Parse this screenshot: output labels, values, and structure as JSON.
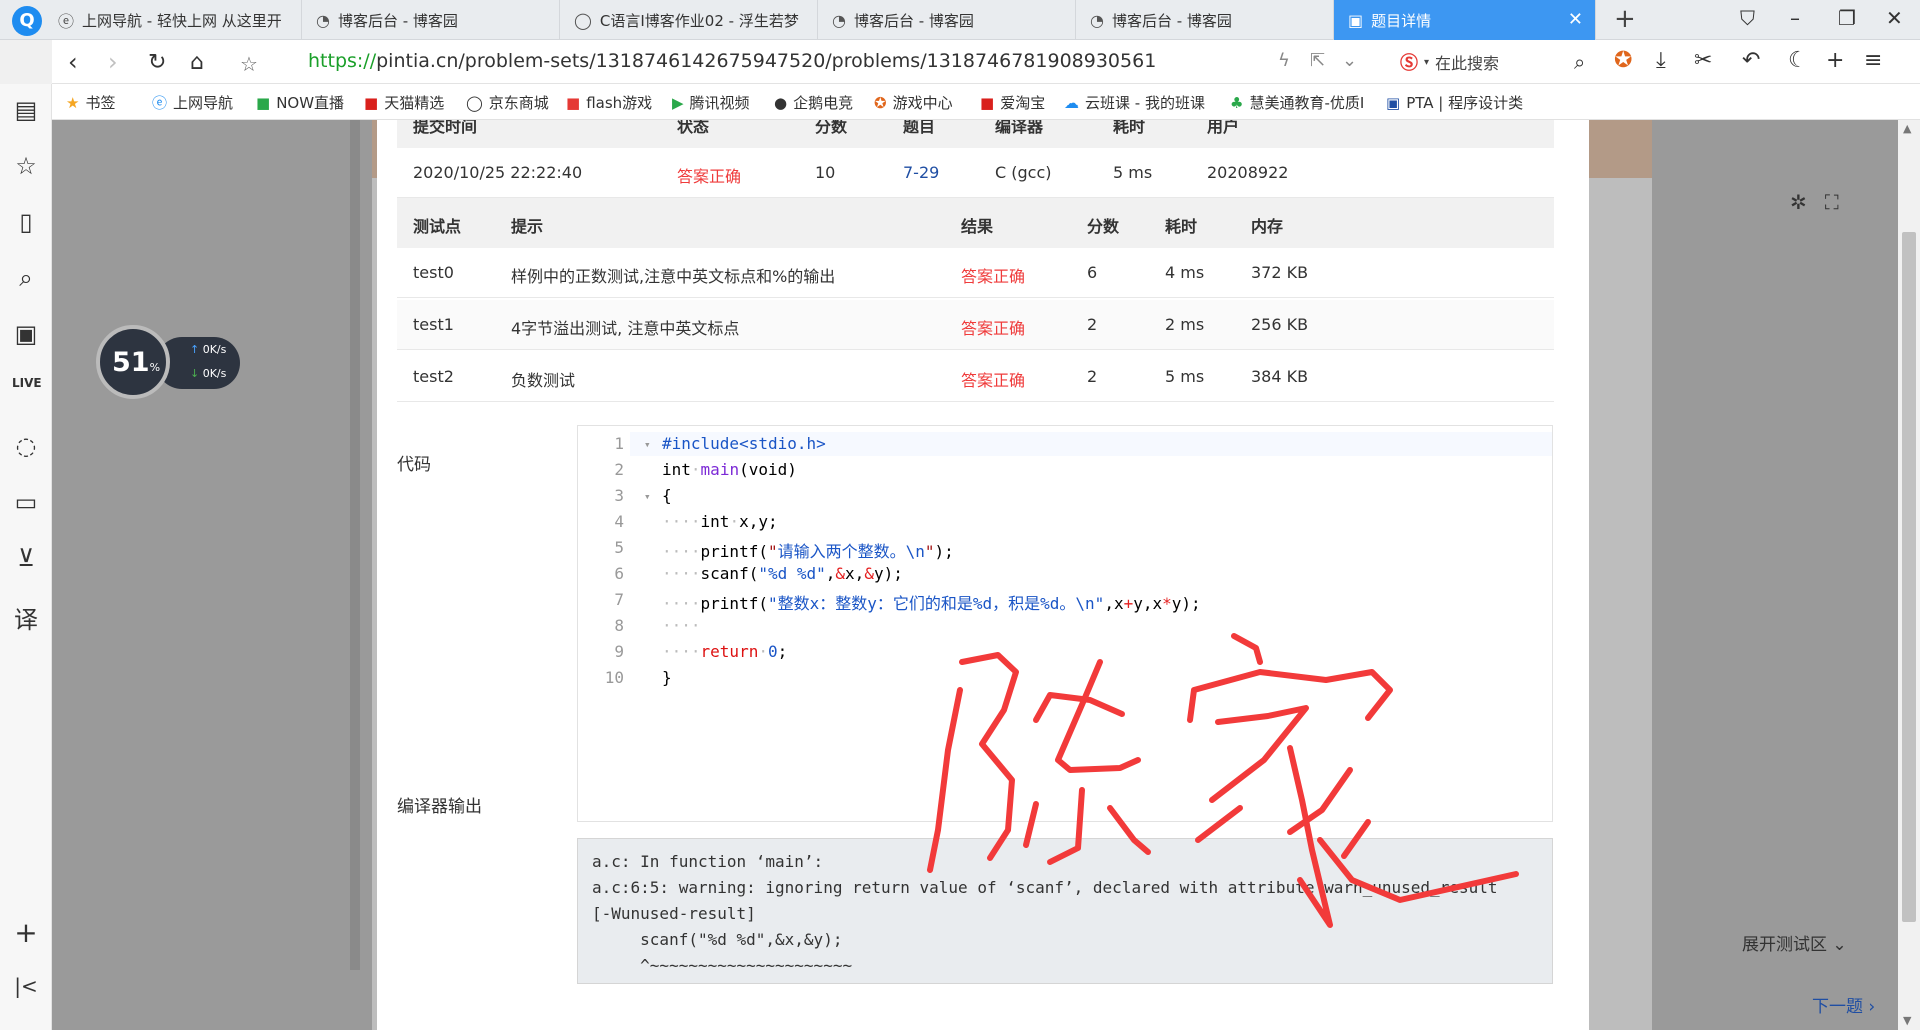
{
  "browser": {
    "tabs": [
      {
        "label": "上网导航 - 轻快上网 从这里开",
        "icon": "e-icon"
      },
      {
        "label": "博客后台 - 博客园",
        "icon": "cnblogs-icon"
      },
      {
        "label": "C语言I博客作业02 - 浮生若梦",
        "icon": "globe-icon"
      },
      {
        "label": "博客后台 - 博客园",
        "icon": "cnblogs-icon"
      },
      {
        "label": "博客后台 - 博客园",
        "icon": "cnblogs-icon"
      },
      {
        "label": "题目详情",
        "icon": "pta-icon"
      }
    ],
    "url_scheme": "https://",
    "url_rest": "pintia.cn/problem-sets/1318746142675947520/problems/1318746781908930561",
    "search_placeholder": "在此搜索",
    "bookmarks": [
      "书签",
      "上网导航",
      "NOW直播",
      "天猫精选",
      "京东商城",
      "flash游戏",
      "腾讯视频",
      "企鹅电竞",
      "游戏中心",
      "爱淘宝",
      "云班课 - 我的班课",
      "慧美通教育-优质I",
      "PTA | 程序设计类"
    ]
  },
  "speed": {
    "percent": "51",
    "percent_unit": "%",
    "up": "0",
    "down": "0",
    "unit": "K/s"
  },
  "submission": {
    "headers": [
      "提交时间",
      "状态",
      "分数",
      "题目",
      "编译器",
      "耗时",
      "用户"
    ],
    "row": [
      "2020/10/25 22:22:40",
      "答案正确",
      "10",
      "7-29",
      "C (gcc)",
      "5 ms",
      "20208922"
    ]
  },
  "tests": {
    "headers": [
      "测试点",
      "提示",
      "结果",
      "分数",
      "耗时",
      "内存"
    ],
    "rows": [
      [
        "test0",
        "样例中的正数测试,注意中英文标点和%的输出",
        "答案正确",
        "6",
        "4 ms",
        "372 KB"
      ],
      [
        "test1",
        "4字节溢出测试, 注意中英文标点",
        "答案正确",
        "2",
        "2 ms",
        "256 KB"
      ],
      [
        "test2",
        "负数测试",
        "答案正确",
        "2",
        "5 ms",
        "384 KB"
      ]
    ]
  },
  "labels": {
    "code": "代码",
    "compiler_output": "编译器输出",
    "expand": "展开测试区",
    "next": "下一题"
  },
  "code_lines": [
    "1",
    "2",
    "3",
    "4",
    "5",
    "6",
    "7",
    "8",
    "9",
    "10"
  ],
  "compiler_output": "a.c: In function ‘main’:\na.c:6:5: warning: ignoring return value of ‘scanf’, declared with attribute warn_unused_result\n[-Wunused-result]\n     scanf(\"%d %d\",&x,&y);\n     ^~~~~~~~~~~~~~~~~~~~~~",
  "signature": "陈家"
}
